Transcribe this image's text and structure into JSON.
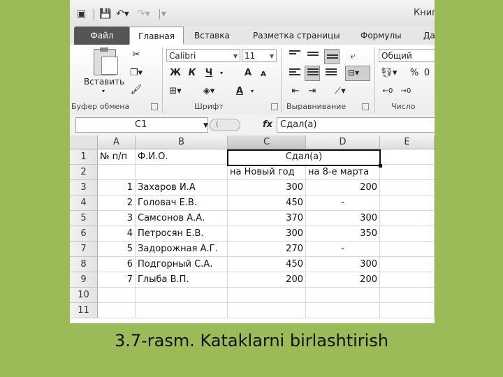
{
  "window": {
    "title": "Книг"
  },
  "tabs": [
    "Файл",
    "Главная",
    "Вставка",
    "Разметка страницы",
    "Формулы",
    "Да"
  ],
  "ribbon": {
    "clipboard": {
      "paste_label": "Вставить",
      "group_label": "Буфер обмена"
    },
    "font": {
      "name": "Calibri",
      "size": "11",
      "bold": "Ж",
      "italic": "К",
      "underline": "Ч",
      "grow": "A",
      "shrink": "A",
      "color": "A",
      "group_label": "Шрифт"
    },
    "alignment": {
      "group_label": "Выравнивание"
    },
    "number": {
      "format": "Общий",
      "percent": "%",
      "group_label": "Число"
    }
  },
  "formula_bar": {
    "name_box": "C1",
    "fx": "fx",
    "value": "Сдал(а)"
  },
  "columns": [
    "A",
    "B",
    "C",
    "D",
    "E"
  ],
  "rows": [
    "1",
    "2",
    "3",
    "4",
    "5",
    "6",
    "7",
    "8",
    "9",
    "10",
    "11"
  ],
  "cells": {
    "r1": {
      "a": "№ п/п",
      "b": "Ф.И.О.",
      "cd": "Сдал(а)"
    },
    "r2": {
      "c": "на Новый год",
      "d": "на 8-е марта"
    },
    "data": [
      {
        "n": "1",
        "name": "Захаров И.А",
        "c": "300",
        "d": "200"
      },
      {
        "n": "2",
        "name": "Головач Е.В.",
        "c": "450",
        "d": "-"
      },
      {
        "n": "3",
        "name": "Самсонов А.А.",
        "c": "370",
        "d": "300"
      },
      {
        "n": "4",
        "name": "Петросян Е.В.",
        "c": "300",
        "d": "350"
      },
      {
        "n": "5",
        "name": "Задорожная А.Г.",
        "c": "270",
        "d": "-"
      },
      {
        "n": "6",
        "name": "Подгорный С.А.",
        "c": "450",
        "d": "300"
      },
      {
        "n": "7",
        "name": "Глыба В.П.",
        "c": "200",
        "d": "200"
      }
    ]
  },
  "caption": "3.7-rasm. Kataklarni birlashtirish"
}
